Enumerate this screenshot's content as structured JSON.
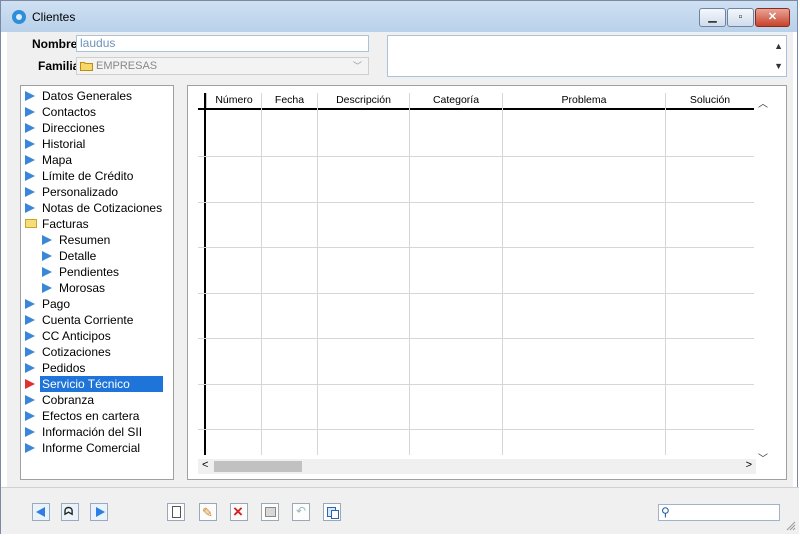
{
  "window": {
    "title": "Clientes"
  },
  "header": {
    "nombre_label": "Nombre",
    "nombre_value": "laudus",
    "familia_label": "Familia",
    "familia_value": "EMPRESAS"
  },
  "tree": {
    "items": [
      "Datos Generales",
      "Contactos",
      "Direcciones",
      "Historial",
      "Mapa",
      "Límite de Crédito",
      "Personalizado",
      "Notas de Cotizaciones",
      "Facturas",
      "Resumen",
      "Detalle",
      "Pendientes",
      "Morosas",
      "Pago",
      "Cuenta Corriente",
      "CC Anticipos",
      "Cotizaciones",
      "Pedidos",
      "Servicio Técnico",
      "Cobranza",
      "Efectos en cartera",
      "Información del SII",
      "Informe Comercial"
    ],
    "selected": "Servicio Técnico"
  },
  "grid": {
    "columns": [
      "Número",
      "Fecha",
      "Descripción",
      "Categoría",
      "Problema",
      "Solución"
    ]
  },
  "colors": {
    "accent": "#1e74d8",
    "arrow": "#3a87d8",
    "selected_arrow": "#e03030"
  }
}
